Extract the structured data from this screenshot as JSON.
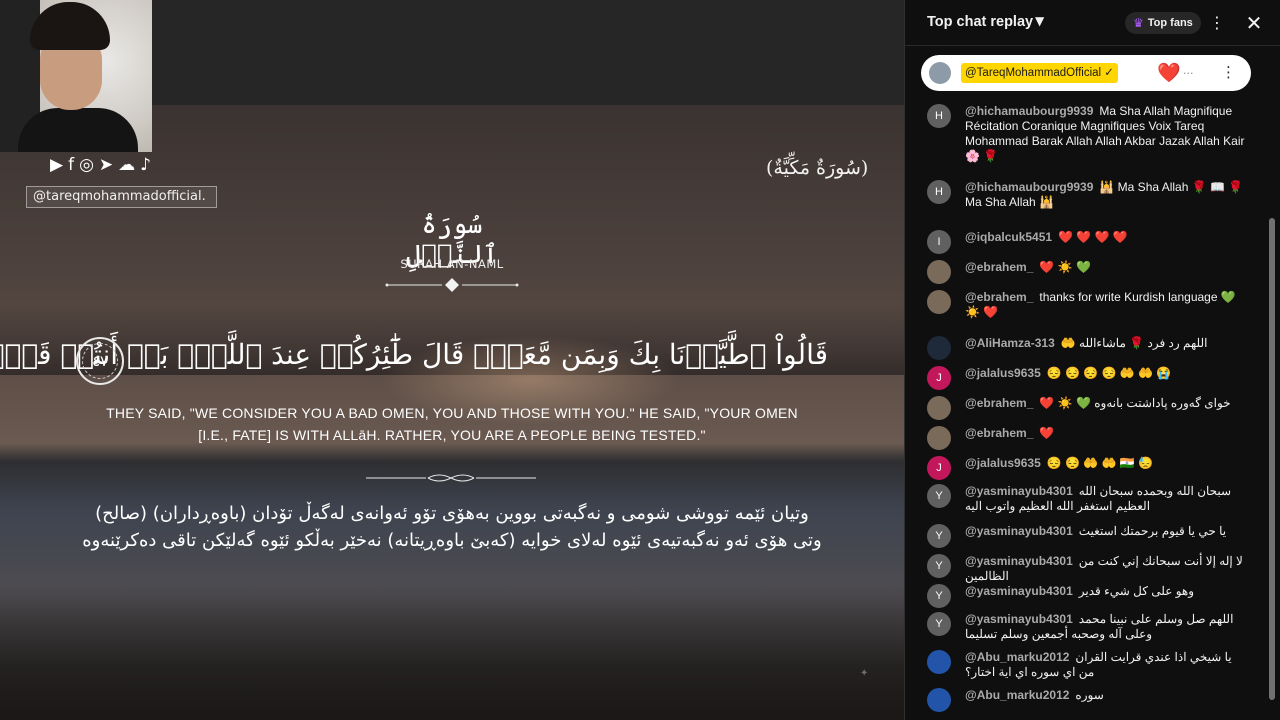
{
  "video": {
    "social_icons": [
      "youtube-icon",
      "facebook-icon",
      "instagram-icon",
      "telegram-icon",
      "soundcloud-icon",
      "tiktok-icon"
    ],
    "social_glyphs": [
      "▶",
      "f",
      "◎",
      "➤",
      "☁",
      "♪"
    ],
    "handle": "@tareqmohammadofficial.",
    "makkiya": "(سُورَةٌ مَكِّيَّةٌ)",
    "surah_arabic": "سُورَةُ ٱلنَّمۡلِ",
    "surah_english": "SURAH AN-NAML",
    "verse_arabic": "قَالُواْ ٱطَّيَّرۡنَا بِكَ وَبِمَن مَّعَكَۚ قَالَ طَٰٓئِرُكُمۡ عِندَ ٱللَّهِۖ بَلۡ أَنتُمۡ قَوۡمٞ تُفۡتَنُونَ",
    "ayah_number": "٤٧",
    "verse_english_line1": "THEY SAID, \"WE CONSIDER YOU A BAD OMEN, YOU AND THOSE WITH YOU.\" HE SAID, \"YOUR OMEN",
    "verse_english_line2": "[I.E., FATE] IS WITH ALLāH. RATHER, YOU ARE A PEOPLE BEING TESTED.\"",
    "verse_kurdish_line1": "وتیان ئێمە تووشی شومی و نەگبەتی بووین بەهۆی تۆو ئەوانەی لەگەڵ تۆدان (باوەڕداران) (صالح)",
    "verse_kurdish_line2": "وتی هۆی ئەو نەگبەتیەی ئێوە لەلای خوایە (کەبێ باوەڕیتانە) نەخێر بەڵکو ئێوە گەلێکن تاقی دەکرێنەوە"
  },
  "chat": {
    "title": "Top chat replay",
    "top_fans_label": "Top fans",
    "pinned": {
      "author": "@TareqMohammadOfficial ✓",
      "emoji": "❤️",
      "trailing": "..."
    },
    "messages": [
      {
        "author": "@hichamaubourg9939",
        "initial": "H",
        "avatar_color": "#606060",
        "text": "Ma Sha Allah Magnifique Récitation Coranique Magnifiques Voix Tareq Mohammad Barak Allah Allah Akbar Jazak Allah Kair 🌸 🌹"
      },
      {
        "author": "@hichamaubourg9939",
        "initial": "H",
        "avatar_color": "#606060",
        "text": "🕌 Ma Sha Allah 🌹 📖 🌹 Ma Sha Allah 🕌"
      },
      {
        "author": "@iqbalcuk5451",
        "initial": "I",
        "avatar_color": "#606060",
        "text": "❤️ ❤️ ❤️ ❤️"
      },
      {
        "author": "@ebrahem_",
        "initial": "",
        "avatar_color": "#7a6a5a",
        "text": "❤️ ☀️ 💚"
      },
      {
        "author": "@ebrahem_",
        "initial": "",
        "avatar_color": "#7a6a5a",
        "text": "thanks for write Kurdish language 💚 ☀️ ❤️"
      },
      {
        "author": "@AliHamza-313",
        "initial": "",
        "avatar_color": "#1e2a3a",
        "text": "🤲 اللهم رد فرد 🌹 ماشاءالله"
      },
      {
        "author": "@jalalus9635",
        "initial": "J",
        "avatar_color": "#c2185b",
        "text": "😔 😔 😔 😔 🤲 🤲 😭"
      },
      {
        "author": "@ebrahem_",
        "initial": "",
        "avatar_color": "#7a6a5a",
        "text": "❤️ ☀️ 💚 خوای گەورە پاداشتت بانەوە"
      },
      {
        "author": "@ebrahem_",
        "initial": "",
        "avatar_color": "#7a6a5a",
        "text": "❤️"
      },
      {
        "author": "@jalalus9635",
        "initial": "J",
        "avatar_color": "#c2185b",
        "text": "😔 😔 🤲 🤲 🇮🇳 😓"
      },
      {
        "author": "@yasminayub4301",
        "initial": "Y",
        "avatar_color": "#606060",
        "text": "سبحان الله وبحمده سبحان الله العظيم استغفر الله العظيم واتوب اليه"
      },
      {
        "author": "@yasminayub4301",
        "initial": "Y",
        "avatar_color": "#606060",
        "text": "يا حي يا قيوم برحمتك استغيث"
      },
      {
        "author": "@yasminayub4301",
        "initial": "Y",
        "avatar_color": "#606060",
        "text": "لا إله إلا أنت سبحانك إني كنت من الظالمين"
      },
      {
        "author": "@yasminayub4301",
        "initial": "Y",
        "avatar_color": "#606060",
        "text": "وهو على كل شيء قدير"
      },
      {
        "author": "@yasminayub4301",
        "initial": "Y",
        "avatar_color": "#606060",
        "text": "اللهم صل وسلم على نبينا محمد وعلى آله وصحبه أجمعين وسلم تسليما"
      },
      {
        "author": "@Abu_marku2012",
        "initial": "",
        "avatar_color": "#2255aa",
        "text": "يا شيخي اذا عندي قرايت القران من اي سوره اي اية اختار؟"
      },
      {
        "author": "@Abu_marku2012",
        "initial": "",
        "avatar_color": "#2255aa",
        "text": "سوره"
      }
    ]
  }
}
